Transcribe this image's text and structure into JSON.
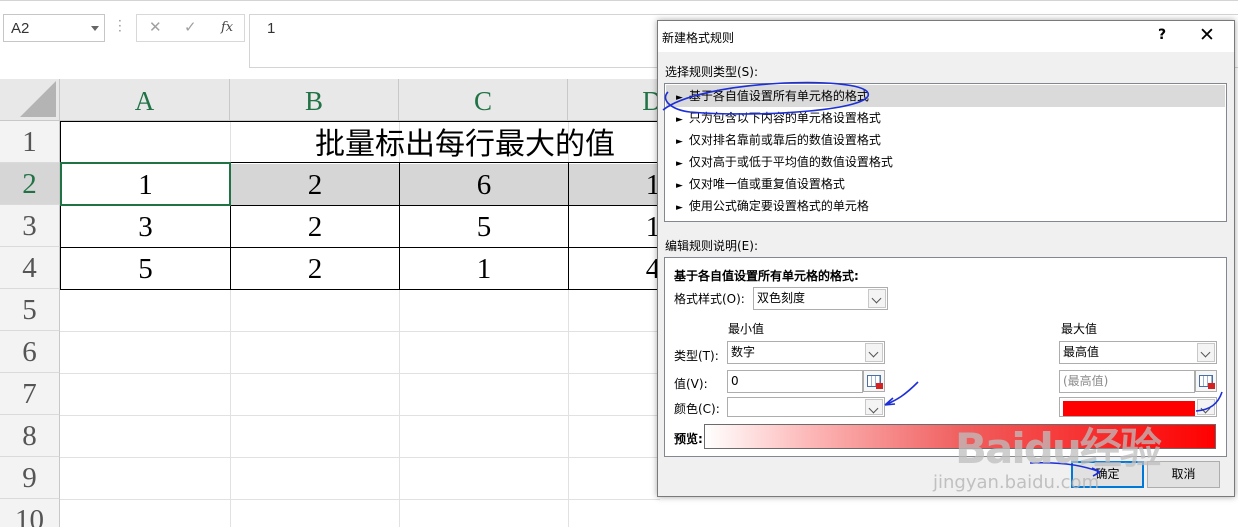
{
  "formula_bar": {
    "name_box": "A2",
    "cancel_glyph": "✕",
    "enter_glyph": "✓",
    "fx_label": "fx",
    "formula_value": "1"
  },
  "sheet": {
    "columns": [
      "A",
      "B",
      "C",
      "D"
    ],
    "rows": [
      "1",
      "2",
      "3",
      "4",
      "5",
      "6",
      "7",
      "8",
      "9",
      "10"
    ],
    "active_row": "2",
    "title": "批量标出每行最大的值",
    "data": [
      [
        "1",
        "2",
        "6",
        "1"
      ],
      [
        "3",
        "2",
        "5",
        "1"
      ],
      [
        "5",
        "2",
        "1",
        "4"
      ]
    ]
  },
  "dialog": {
    "title": "新建格式规则",
    "help": "?",
    "close": "✕",
    "rule_type_label": "选择规则类型(S):",
    "rule_types": [
      "基于各自值设置所有单元格的格式",
      "只为包含以下内容的单元格设置格式",
      "仅对排名靠前或靠后的数值设置格式",
      "仅对高于或低于平均值的数值设置格式",
      "仅对唯一值或重复值设置格式",
      "使用公式确定要设置格式的单元格"
    ],
    "selected_rule_index": 0,
    "arrow_glyph": "►",
    "edit_label": "编辑规则说明(E):",
    "edit_heading": "基于各自值设置所有单元格的格式:",
    "format_style_label": "格式样式(O):",
    "format_style_value": "双色刻度",
    "min_header": "最小值",
    "max_header": "最大值",
    "type_label": "类型(T):",
    "value_label": "值(V):",
    "color_label": "颜色(C):",
    "min_type": "数字",
    "max_type": "最高值",
    "min_value": "0",
    "max_value_placeholder": "(最高值)",
    "min_color": "#ffffff",
    "max_color": "#ff0000",
    "preview_label": "预览:",
    "ok": "确定",
    "cancel": "取消"
  },
  "watermark": {
    "brand": "Baidu经验",
    "url": "jingyan.baidu.com"
  }
}
